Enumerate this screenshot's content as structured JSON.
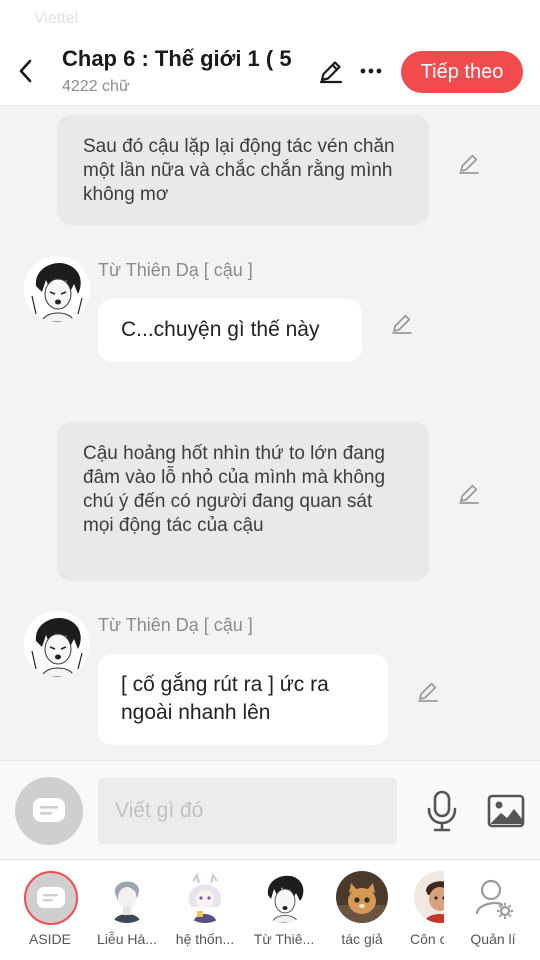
{
  "status": {
    "carrier": "Viettel"
  },
  "header": {
    "title": "Chap 6 : Thế giới 1 ( 5",
    "word_count": "4222 chữ",
    "next_label": "Tiếp theo"
  },
  "messages": [
    {
      "type": "narration",
      "text": "Sau đó cậu lặp lại động tác vén chăn một lần nữa và chắc chắn rằng mình không mơ"
    },
    {
      "type": "dialogue",
      "speaker": "Từ Thiên Dạ [ cậu ]",
      "text": "C...chuyện gì thế này"
    },
    {
      "type": "narration",
      "text": "Cậu hoảng hốt nhìn thứ to lớn đang đâm vào lỗ nhỏ của mình mà không chú ý đến có người đang quan sát mọi động tác của cậu"
    },
    {
      "type": "dialogue",
      "speaker": "Từ Thiên Dạ [ cậu ]",
      "text": "[ cố gắng rút ra ] ức ra ngoài nhanh lên"
    }
  ],
  "input": {
    "placeholder": "Viết gì đó"
  },
  "characters": [
    {
      "label": "ASIDE"
    },
    {
      "label": "Liễu Hà..."
    },
    {
      "label": "hệ thốn..."
    },
    {
      "label": "Từ Thiê..."
    },
    {
      "label": "tác giả"
    },
    {
      "label": "Côn c"
    }
  ],
  "manage_label": "Quản lí",
  "colors": {
    "accent": "#f24b4e",
    "narration_bg": "#e9e9e9",
    "chat_bg": "#f3f3f3"
  }
}
